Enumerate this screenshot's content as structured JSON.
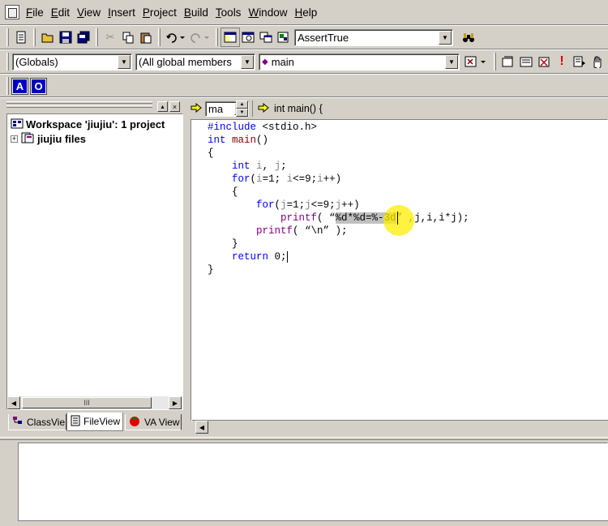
{
  "menu": [
    "File",
    "Edit",
    "View",
    "Insert",
    "Project",
    "Build",
    "Tools",
    "Window",
    "Help"
  ],
  "menu_accel": [
    "F",
    "E",
    "V",
    "I",
    "P",
    "B",
    "T",
    "W",
    "H"
  ],
  "toolbar": {
    "find_combo_value": "AssertTrue"
  },
  "wizardbar": {
    "scope": "(Globals)",
    "members": "(All global members",
    "function": "main"
  },
  "va_buttons": [
    "A",
    "O"
  ],
  "workspace": {
    "root": "Workspace 'jiujiu': 1 project",
    "child": "jiujiu files",
    "tabs": [
      "ClassVie",
      "FileView",
      "VA View"
    ],
    "hscroll_grip": "III"
  },
  "editor_nav": {
    "left_combo": "ma",
    "right_text": "int main() {"
  },
  "code": [
    "#include <stdio.h>",
    "int main()",
    "{",
    "    int i, j;",
    "    for(i=1; i<=9;i++)",
    "    {",
    "        for(j=1;j<=9;j++)",
    "            printf( “%d*%d=%-3d” ,j,i,i*j);",
    "        printf( “\\n” );",
    "    }",
    "    return 0;",
    "}"
  ],
  "colors": {
    "chrome": "#d4d0c8",
    "keyword": "#0000ff",
    "cursor_highlight": "#ffee00"
  }
}
